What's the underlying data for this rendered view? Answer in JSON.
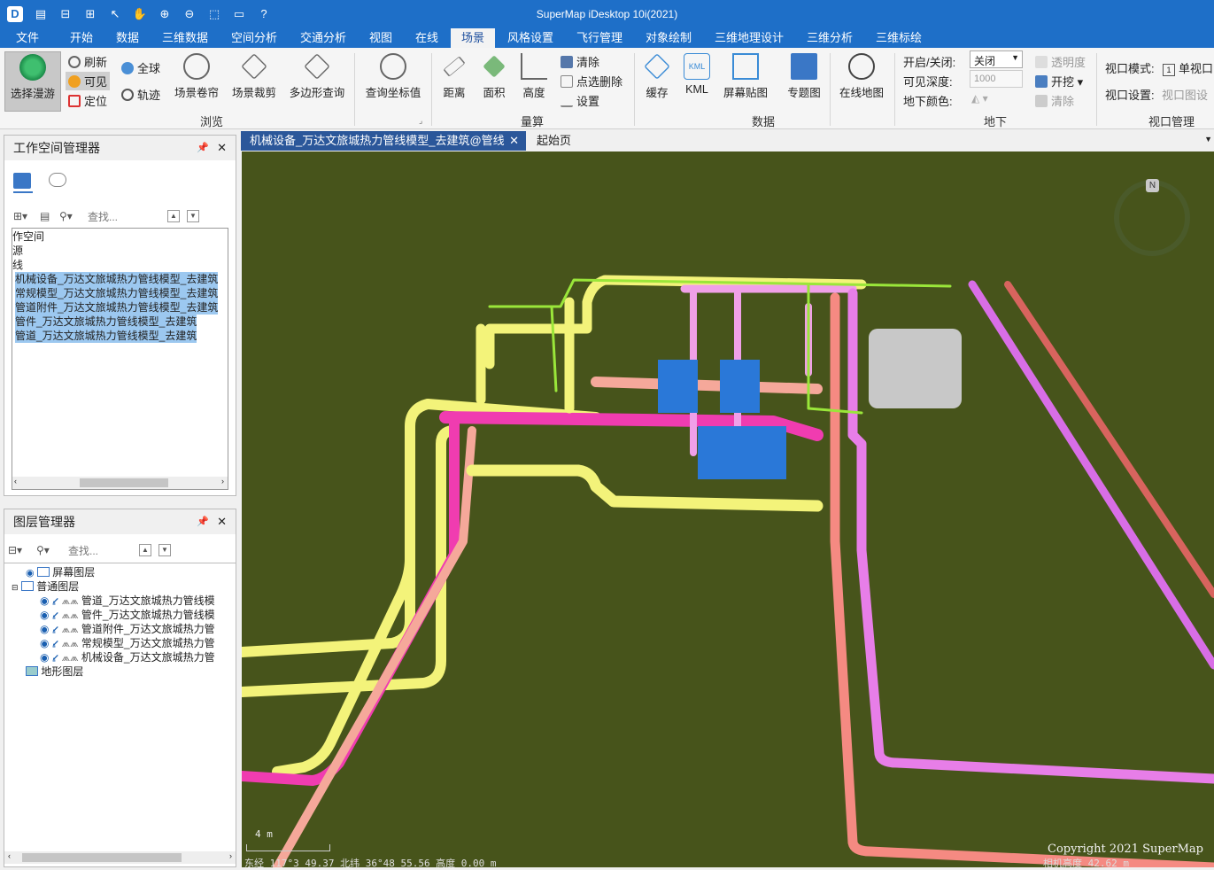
{
  "app": {
    "title": "SuperMap iDesktop 10i(2021)"
  },
  "menu": [
    "文件",
    "开始",
    "数据",
    "三维数据",
    "空间分析",
    "交通分析",
    "视图",
    "在线",
    "场景",
    "风格设置",
    "飞行管理",
    "对象绘制",
    "三维地理设计",
    "三维分析",
    "三维标绘"
  ],
  "menu_active": "场景",
  "ribbon": {
    "roam": "选择漫游",
    "refresh": "刷新",
    "visible": "可见",
    "locate": "定位",
    "globe": "全球",
    "track": "轨迹",
    "curtain": "场景卷帘",
    "clip": "场景裁剪",
    "polygon_query": "多边形查询",
    "browse_group": "浏览",
    "query_coord": "查询坐标值",
    "distance": "距离",
    "area": "面积",
    "height": "高度",
    "clear": "清除",
    "point_delete": "点选删除",
    "settings": "设置",
    "measure_group": "量算",
    "cache": "缓存",
    "kml": "KML",
    "screen_paste": "屏幕贴图",
    "thematic": "专题图",
    "online_map": "在线地图",
    "data_group": "数据",
    "open_close_label": "开启/关闭:",
    "open_close_value": "关闭",
    "depth_label": "可见深度:",
    "depth_value": "1000",
    "ground_color_label": "地下颜色:",
    "transparency": "透明度",
    "excavate": "开挖",
    "clear2": "清除",
    "underground_group": "地下",
    "viewport_mode_label": "视口模式:",
    "viewport_mode_value": "单视口",
    "viewport_settings_label": "视口设置:",
    "viewport_settings_value": "视口图设",
    "viewport_group": "视口管理"
  },
  "workspace": {
    "title": "工作空间管理器",
    "search_placeholder": "查找...",
    "items": [
      "作空间",
      "源",
      "线",
      "机械设备_万达文旅城热力管线模型_去建筑",
      "常规模型_万达文旅城热力管线模型_去建筑",
      "管道附件_万达文旅城热力管线模型_去建筑",
      "管件_万达文旅城热力管线模型_去建筑",
      "管道_万达文旅城热力管线模型_去建筑"
    ]
  },
  "layers": {
    "title": "图层管理器",
    "search_placeholder": "查找...",
    "screen": "屏幕图层",
    "normal": "普通图层",
    "items": [
      "管道_万达文旅城热力管线模",
      "管件_万达文旅城热力管线模",
      "管道附件_万达文旅城热力管",
      "常规模型_万达文旅城热力管",
      "机械设备_万达文旅城热力管"
    ],
    "terrain": "地形图层"
  },
  "tabs": {
    "scene": "机械设备_万达文旅城热力管线模型_去建筑@管线",
    "start": "起始页"
  },
  "scene": {
    "compass": "N",
    "scale": "4 m",
    "copyright": "Copyright 2021 SuperMap",
    "status_left": "东经  117°3    49.37    北纬  36°48    55.56  高度  0.00  m",
    "status_right": "相机高度  42.62  m"
  }
}
